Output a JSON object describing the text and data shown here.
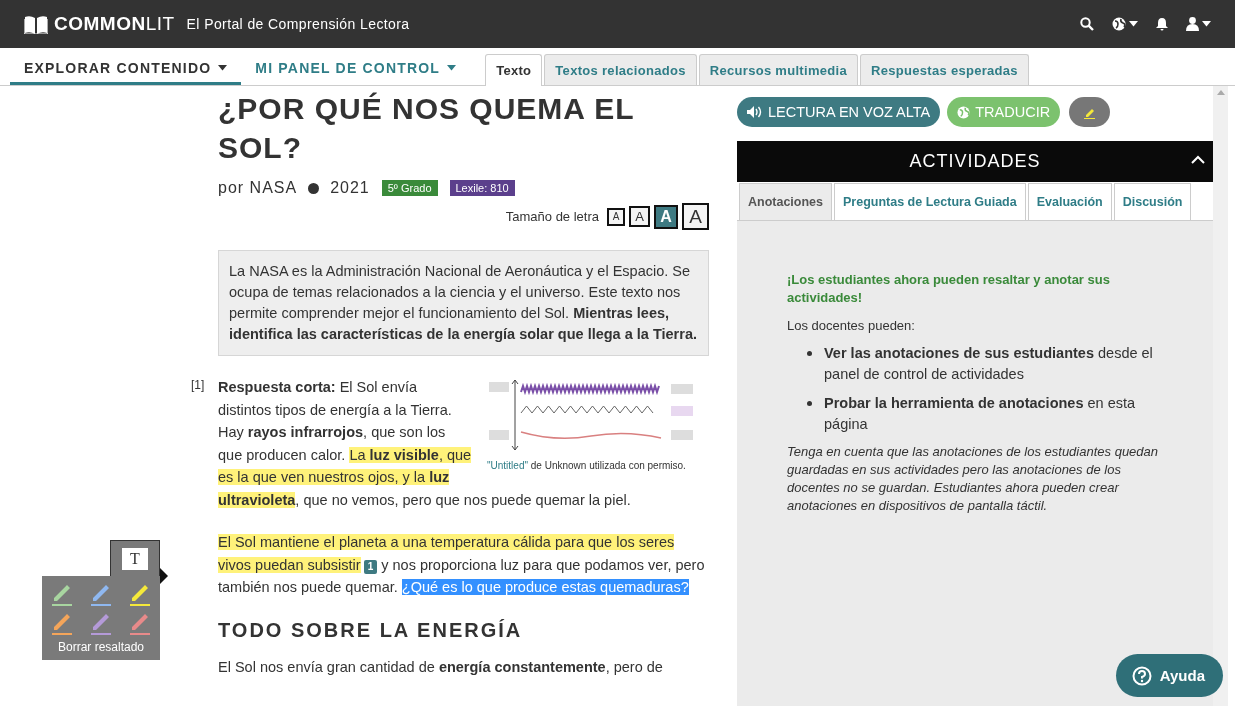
{
  "topbar": {
    "logo": "**COMMON**LIT",
    "subtitle": "El Portal de Comprensión Lectora"
  },
  "nav": {
    "menus": [
      {
        "label": "EXPLORAR CONTENIDO",
        "selected": true
      },
      {
        "label": "MI PANEL DE CONTROL",
        "selected": false
      }
    ],
    "tabs": [
      {
        "label": "Texto",
        "selected": true
      },
      {
        "label": "Textos relacionados",
        "selected": false
      },
      {
        "label": "Recursos multimedia",
        "selected": false
      },
      {
        "label": "Respuestas esperadas",
        "selected": false
      }
    ]
  },
  "article": {
    "title": "¿POR QUÉ NOS QUEMA EL SOL?",
    "author": "por NASA",
    "year": "2021",
    "badges": [
      {
        "text": "5º Grado",
        "color": "#3a8a3a"
      },
      {
        "text": "Lexile: 810",
        "color": "#5b3f8c"
      }
    ],
    "font_size": {
      "label": "Tamaño de letra",
      "options": [
        {
          "label": "A",
          "selected": false
        },
        {
          "label": "A",
          "selected": false
        },
        {
          "label": "A",
          "selected": true
        },
        {
          "label": "A",
          "selected": false
        }
      ]
    },
    "intro": "La NASA es la Administración Nacional de Aeronáutica y el Espacio. Se ocupa de temas relacionados a la ciencia y el universo. Este texto nos permite comprender mejor el funcionamiento del Sol. **Mientras lees, identifica las características de la energía solar que llega a la Tierra.**",
    "figure": {
      "kind": "picture",
      "caption_link": "\"Untitled\"",
      "caption": " de Unknown utilizada con permiso."
    },
    "paragraphs": [
      {
        "number": "[1]",
        "segments": [
          {
            "kind": "text",
            "text": "**Respuesta corta:** El Sol envía distintos tipos de energía a la Tierra. Hay **rayos infrarrojos**, que son los que producen calor. ",
            "highlighted": false,
            "selected": false
          },
          {
            "kind": "text",
            "text": "La **luz visible**, que es la que ven nuestros ojos, y la **luz ultravioleta**",
            "highlighted": true,
            "selected": false
          },
          {
            "kind": "text",
            "text": ", que no vemos, pero que nos puede quemar la piel.",
            "highlighted": false,
            "selected": false
          }
        ]
      },
      {
        "segments": [
          {
            "kind": "text",
            "text": "El Sol mantiene el planeta a una temperatura cálida para que los seres vivos puedan subsistir",
            "highlighted": true,
            "selected": false
          },
          {
            "kind": "note",
            "text": "1"
          },
          {
            "kind": "text",
            "text": " y nos proporciona luz para que podamos ver, pero también nos puede quemar. ",
            "highlighted": false,
            "selected": false
          },
          {
            "kind": "text",
            "text": "¿Qué es lo que produce estas quemaduras?",
            "highlighted": false,
            "selected": true
          }
        ]
      }
    ],
    "heading": "TODO SOBRE LA ENERGÍA",
    "last_paragraph": "El Sol nos envía gran cantidad de **energía constantemente**, pero de"
  },
  "highlighter": {
    "note_button": "T",
    "pens": [
      {
        "color": "#a8d5a0"
      },
      {
        "color": "#8fb8f0"
      },
      {
        "color": "#f5e93a"
      },
      {
        "color": "#f4a55a"
      },
      {
        "color": "#b49ad8"
      },
      {
        "color": "#e88a8a"
      }
    ],
    "clear": "Borrar resaltado"
  },
  "tools": [
    {
      "kind": "read",
      "label": "LECTURA EN VOZ ALTA"
    },
    {
      "kind": "translate",
      "label": "TRADUCIR"
    },
    {
      "kind": "highlight"
    }
  ],
  "activities": {
    "title": "ACTIVIDADES",
    "tabs": [
      {
        "label": "Anotaciones",
        "selected": true
      },
      {
        "label": "Preguntas de Lectura Guiada",
        "selected": false
      },
      {
        "label": "Evaluación",
        "selected": false
      },
      {
        "label": "Discusión",
        "selected": false
      }
    ],
    "notice": "¡Los estudiantes ahora pueden resaltar y anotar sus actividades!",
    "lead": "Los docentes pueden:",
    "bullets": [
      "**Ver las anotaciones de sus estudiantes** desde el panel de control de actividades",
      "**Probar la herramienta de anotaciones** en esta página"
    ],
    "note": "Tenga en cuenta que las anotaciones de los estudiantes quedan guardadas en sus actividades pero las anotaciones de los docentes no se guardan. Estudiantes ahora pueden crear anotaciones en dispositivos de pantalla táctil."
  },
  "help": "Ayuda"
}
